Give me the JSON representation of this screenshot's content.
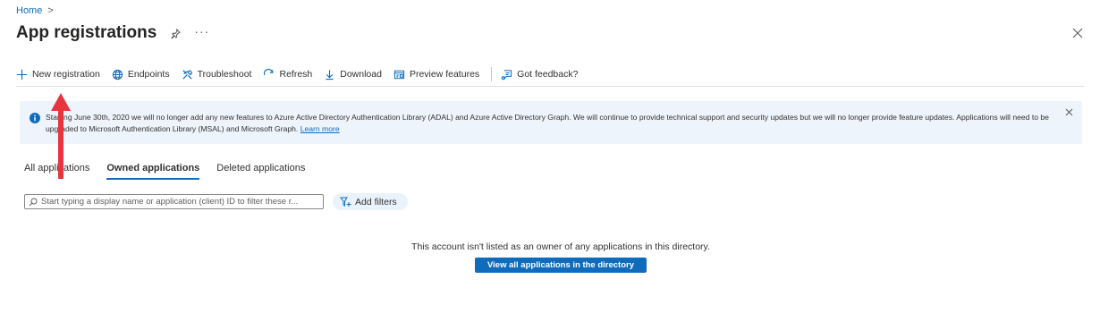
{
  "breadcrumb": {
    "home": "Home",
    "separator": ">"
  },
  "header": {
    "title": "App registrations",
    "more": "···"
  },
  "toolbar": {
    "new_registration": "New registration",
    "endpoints": "Endpoints",
    "troubleshoot": "Troubleshoot",
    "refresh": "Refresh",
    "download": "Download",
    "preview_features": "Preview features",
    "feedback": "Got feedback?"
  },
  "banner": {
    "text": "Starting June 30th, 2020 we will no longer add any new features to Azure Active Directory Authentication Library (ADAL) and Azure Active Directory Graph. We will continue to provide technical support and security updates but we will no longer provide feature updates. Applications will need to be upgraded to Microsoft Authentication Library (MSAL) and Microsoft Graph.",
    "link": "Learn more"
  },
  "tabs": [
    {
      "label": "All applications",
      "active": false
    },
    {
      "label": "Owned applications",
      "active": true
    },
    {
      "label": "Deleted applications",
      "active": false
    }
  ],
  "search": {
    "placeholder": "Start typing a display name or application (client) ID to filter these r..."
  },
  "filters": {
    "add_label": "Add filters"
  },
  "empty_state": {
    "message": "This account isn't listed as an owner of any applications in this directory.",
    "button": "View all applications in the directory"
  },
  "colors": {
    "accent": "#0f6cbd",
    "banner_bg": "#eef4fb",
    "annotation_arrow": "#e8343f"
  }
}
